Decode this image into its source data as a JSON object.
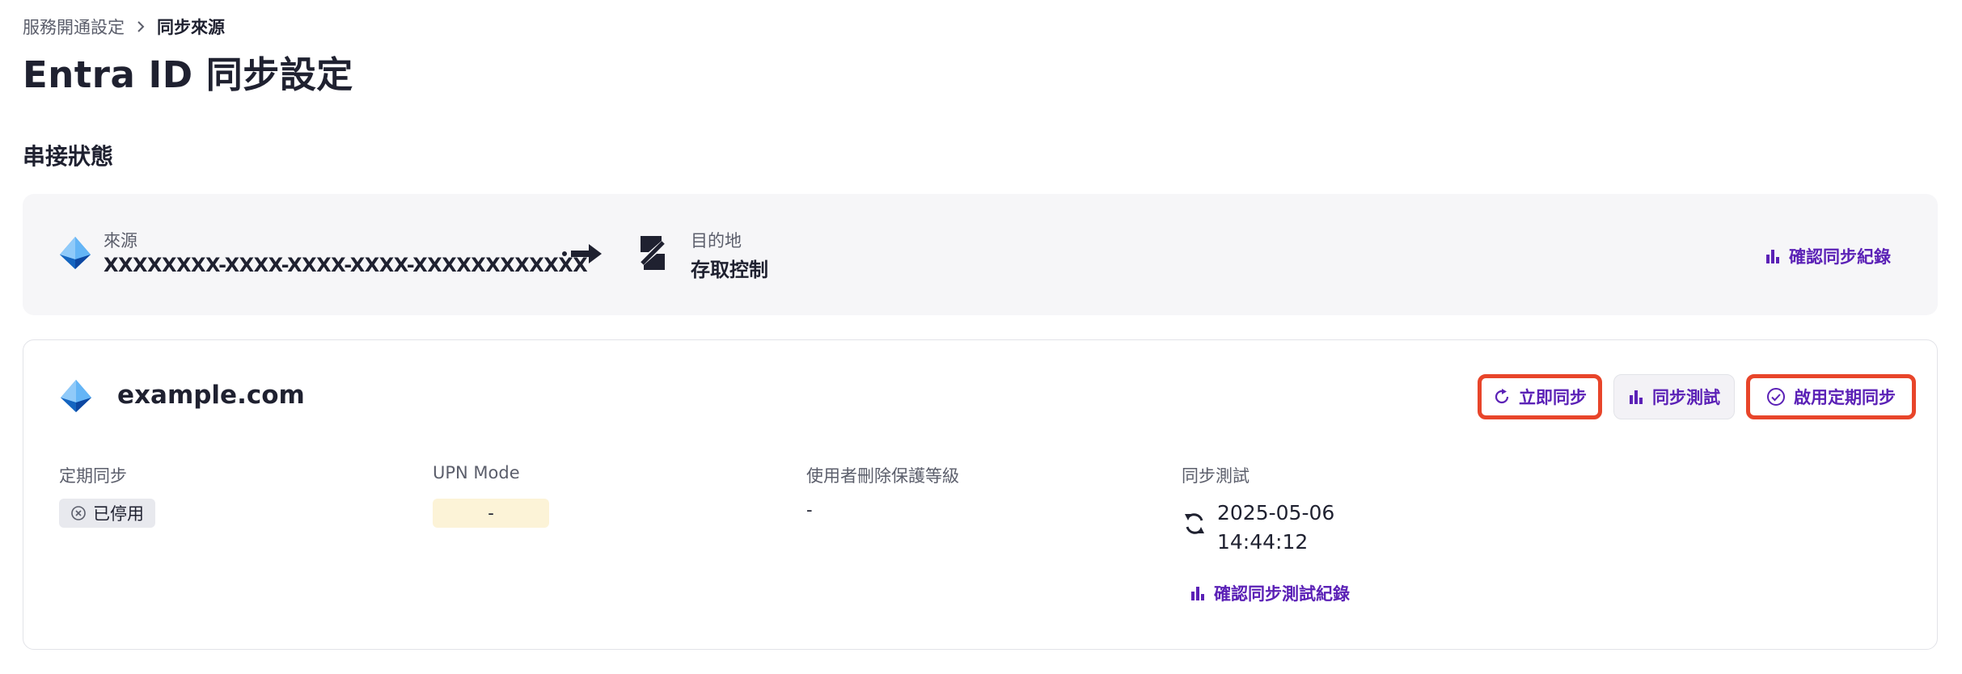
{
  "breadcrumb": {
    "parent": "服務開通設定",
    "current": "同步來源"
  },
  "page_title": "Entra ID 同步設定",
  "connection_section": {
    "title": "串接狀態",
    "source_label": "來源",
    "source_value": "XXXXXXXX-XXXX-XXXX-XXXX-XXXXXXXXXXXX",
    "destination_label": "目的地",
    "destination_value": "存取控制",
    "sync_log_link": "確認同步紀錄"
  },
  "domain_card": {
    "domain": "example.com",
    "buttons": {
      "sync_now": "立即同步",
      "sync_test": "同步測試",
      "enable_scheduled": "啟用定期同步"
    },
    "fields": {
      "scheduled_sync_label": "定期同步",
      "scheduled_sync_status": "已停用",
      "upn_mode_label": "UPN Mode",
      "upn_mode_value": "-",
      "delete_protection_label": "使用者刪除保護等級",
      "delete_protection_value": "-",
      "sync_test_label": "同步測試",
      "sync_test_date": "2025-05-06",
      "sync_test_time": "14:44:12",
      "sync_test_log_link": "確認同步測試紀錄"
    }
  },
  "colors": {
    "accent": "#5b21b6",
    "highlight_border": "#e8452a",
    "title": "#1f2130",
    "muted": "#5b5e6b"
  },
  "icons": [
    "chevron-right-icon",
    "entra-id-logo-icon",
    "arrow-right-icon",
    "access-control-logo-icon",
    "bar-chart-icon",
    "refresh-icon",
    "check-circle-icon",
    "x-circle-icon",
    "sync-icon"
  ]
}
